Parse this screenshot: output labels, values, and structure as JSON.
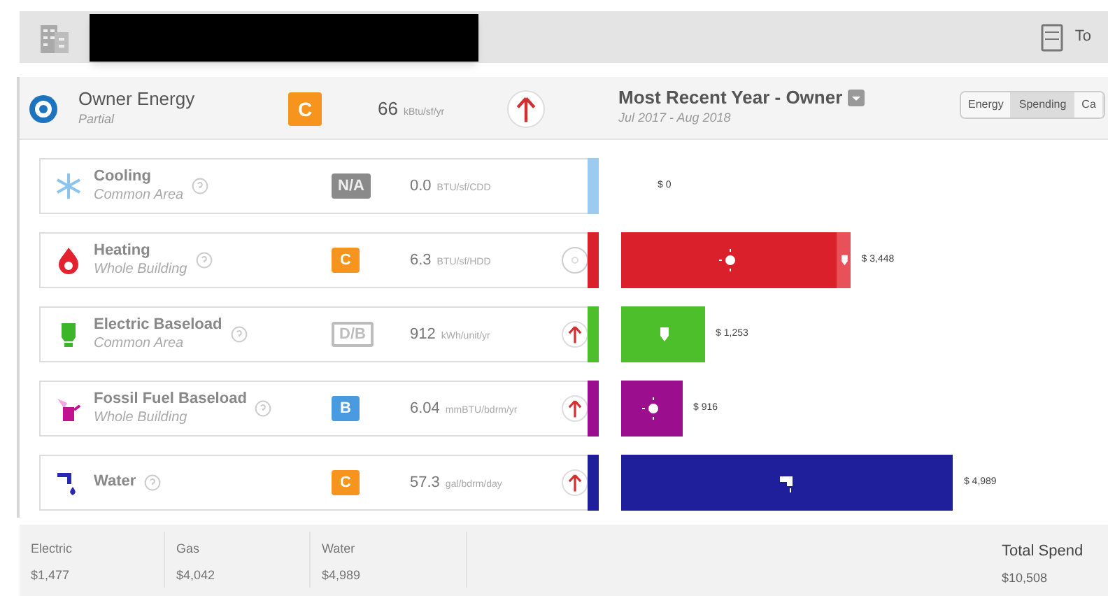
{
  "header": {
    "tools_label": "To"
  },
  "summary": {
    "title": "Owner Energy",
    "subtitle": "Partial",
    "grade": {
      "text": "C",
      "kind": "letter",
      "color": "#f7941d"
    },
    "value": "66",
    "unit": "kBtu/sf/yr",
    "trend": {
      "kind": "up"
    }
  },
  "chart_header": {
    "title": "Most Recent Year - Owner",
    "period": "Jul 2017 - Aug 2018"
  },
  "toggles": [
    {
      "label": "Energy",
      "selected": false
    },
    {
      "label": "Spending",
      "selected": true
    },
    {
      "label": "Ca",
      "selected": false
    }
  ],
  "end_uses": [
    {
      "name": "Cooling",
      "scope": "Common Area",
      "kind": "cooling",
      "color": "#9ccbf2",
      "grade": {
        "text": "N/A",
        "kind": "filled",
        "color": "#8a8a8a"
      },
      "value": "0.0",
      "unit": "BTU/sf/CDD",
      "amount": "$ 0"
    },
    {
      "name": "Heating",
      "scope": "Whole Building",
      "kind": "heating",
      "color": "#d9202b",
      "grade": {
        "text": "C",
        "kind": "letter",
        "color": "#f7941d"
      },
      "value": "6.3",
      "unit": "BTU/sf/HDD",
      "trend": {
        "kind": "neutral"
      },
      "amount": "$ 3,448",
      "segments": [
        {
          "kind": "gas"
        },
        {
          "kind": "electric"
        }
      ]
    },
    {
      "name": "Electric Baseload",
      "scope": "Common Area",
      "kind": "electric",
      "color": "#4cbf2a",
      "grade": {
        "text": "D/B",
        "kind": "outline",
        "color": "#bdbdbd"
      },
      "value": "912",
      "unit": "kWh/unit/yr",
      "trend": {
        "kind": "up"
      },
      "amount": "$ 1,253",
      "segments": [
        {
          "kind": "electric"
        }
      ]
    },
    {
      "name": "Fossil Fuel Baseload",
      "scope": "Whole Building",
      "kind": "fossil",
      "color": "#9b0f8f",
      "grade": {
        "text": "B",
        "kind": "letter",
        "color": "#4a9ae0"
      },
      "value": "6.04",
      "unit": "mmBTU/bdrm/yr",
      "trend": {
        "kind": "up"
      },
      "amount": "$ 916",
      "segments": [
        {
          "kind": "gas"
        }
      ]
    },
    {
      "name": "Water",
      "kind": "water",
      "color": "#1f1f9c",
      "grade": {
        "text": "C",
        "kind": "letter",
        "color": "#f7941d"
      },
      "value": "57.3",
      "unit": "gal/bdrm/day",
      "trend": {
        "kind": "up"
      },
      "amount": "$ 4,989",
      "segments": [
        {
          "kind": "water"
        }
      ]
    }
  ],
  "totals": [
    {
      "label": "Electric",
      "value": "$1,477"
    },
    {
      "label": "Gas",
      "value": "$4,042"
    },
    {
      "label": "Water",
      "value": "$4,989"
    }
  ],
  "total_spend": {
    "label": "Total Spend",
    "value": "$10,508"
  }
}
